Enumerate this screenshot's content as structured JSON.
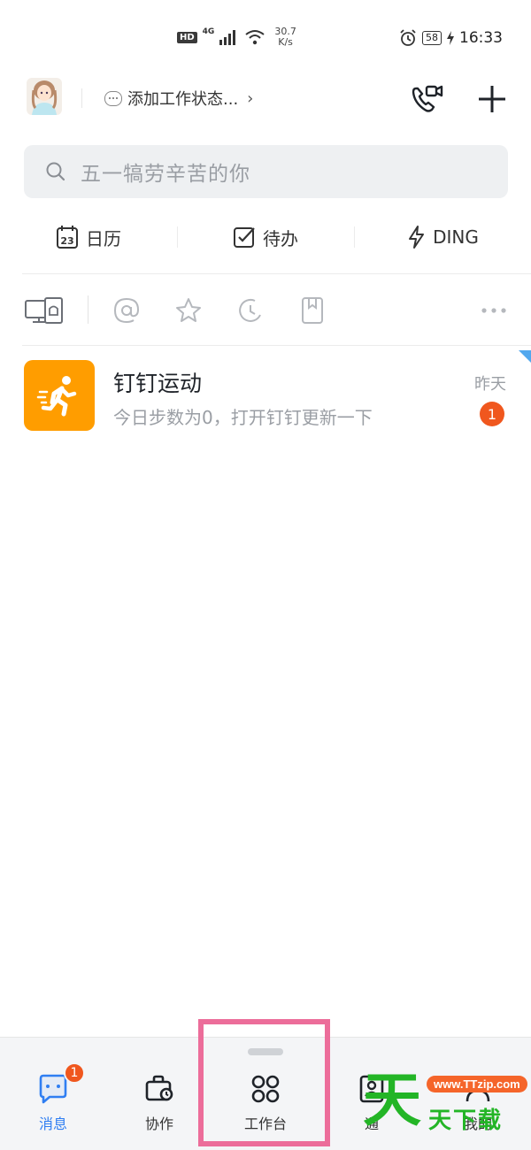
{
  "status_bar": {
    "hd": "HD",
    "network": "4G",
    "speed_value": "30.7",
    "speed_unit": "K/s",
    "battery": "58",
    "time": "16:33"
  },
  "header": {
    "work_status": "添加工作状态...",
    "chevron": "›"
  },
  "search": {
    "placeholder": "五一犒劳辛苦的你"
  },
  "quick_actions": [
    {
      "label": "日历",
      "icon": "calendar-icon",
      "day": "23"
    },
    {
      "label": "待办",
      "icon": "todo-check-icon"
    },
    {
      "label": "DING",
      "icon": "lightning-icon"
    }
  ],
  "filters": [
    {
      "icon": "device-icon"
    },
    {
      "icon": "at-icon"
    },
    {
      "icon": "star-icon"
    },
    {
      "icon": "clock-icon"
    },
    {
      "icon": "bookmark-icon"
    },
    {
      "icon": "more-icon"
    }
  ],
  "messages": [
    {
      "title": "钉钉运动",
      "preview": "今日步数为0，打开钉钉更新一下",
      "time": "昨天",
      "unread": "1",
      "icon": "running-icon",
      "icon_color": "#ff9d00"
    }
  ],
  "tabbar": {
    "tabs": [
      {
        "label": "消息",
        "icon": "chat-icon",
        "badge": "1",
        "active": true
      },
      {
        "label": "协作",
        "icon": "briefcase-icon"
      },
      {
        "label": "工作台",
        "icon": "grid-icon"
      },
      {
        "label": "通",
        "icon": "contacts-icon"
      },
      {
        "label": "我的",
        "icon": "profile-icon"
      }
    ]
  },
  "watermark": {
    "big": "天",
    "url": "www.TTzip.com",
    "small": "天下载"
  },
  "colors": {
    "accent": "#2f7ef2",
    "badge": "#f0571e",
    "highlight": "#ec6d9a"
  }
}
